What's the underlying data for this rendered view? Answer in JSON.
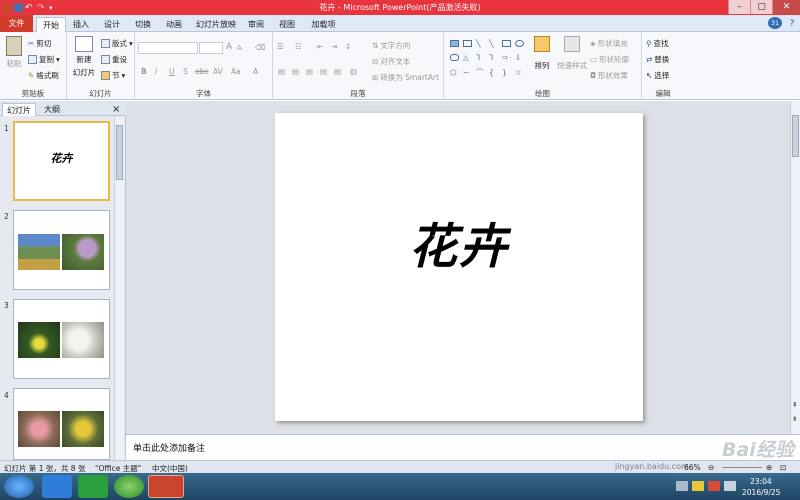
{
  "window": {
    "title": "花卉 - Microsoft PowerPoint(产品激活失败)",
    "minimize": "–",
    "maximize": "▢",
    "close": "✕"
  },
  "tabs": {
    "file": "文件",
    "items": [
      "开始",
      "插入",
      "设计",
      "切换",
      "动画",
      "幻灯片放映",
      "审阅",
      "视图",
      "加载项"
    ],
    "active": "开始",
    "help_badge": "31"
  },
  "ribbon": {
    "clipboard": {
      "label": "剪贴板",
      "paste": "粘贴",
      "cut": "剪切",
      "copy": "复制",
      "format_painter": "格式刷"
    },
    "slides": {
      "label": "幻灯片",
      "new_slide_1": "新建",
      "new_slide_2": "幻灯片",
      "layout": "版式",
      "reset": "重设",
      "section": "节"
    },
    "font": {
      "label": "字体",
      "bold": "B",
      "italic": "I",
      "underline": "U",
      "shadow": "S",
      "strike": "abc",
      "spacing": "AV",
      "case": "Aa",
      "color": "A",
      "grow": "A",
      "shrink": "A"
    },
    "paragraph": {
      "label": "段落",
      "text_direction": "文字方向",
      "align_text": "对齐文本",
      "convert_smartart": "转换为 SmartArt"
    },
    "drawing": {
      "label": "绘图",
      "arrange": "排列",
      "quick_styles": "快速样式",
      "shape_fill": "形状填充",
      "shape_outline": "形状轮廓",
      "shape_effects": "形状效果"
    },
    "editing": {
      "label": "编辑",
      "find": "查找",
      "replace": "替换",
      "select": "选择"
    }
  },
  "panel": {
    "tab_slides": "幻灯片",
    "tab_outline": "大纲",
    "close": "×",
    "slide_numbers": [
      "1",
      "2",
      "3",
      "4"
    ],
    "slide1_title": "花卉"
  },
  "slide": {
    "title": "花卉"
  },
  "notes": {
    "placeholder": "单击此处添加备注"
  },
  "status": {
    "slide_info": "幻灯片 第 1 张，共 8 张",
    "theme": "\"Office 主题\"",
    "language": "中文(中国)",
    "zoom": "66%"
  },
  "watermark": {
    "text": "Bai经验",
    "url": "jingyan.baidu.com"
  },
  "taskbar": {
    "time": "23:04",
    "date": "2016/9/25"
  },
  "colors": {
    "title_bar": "#e8343f",
    "file_tab": "#d23a2c",
    "selected_border": "#e7b94a"
  }
}
